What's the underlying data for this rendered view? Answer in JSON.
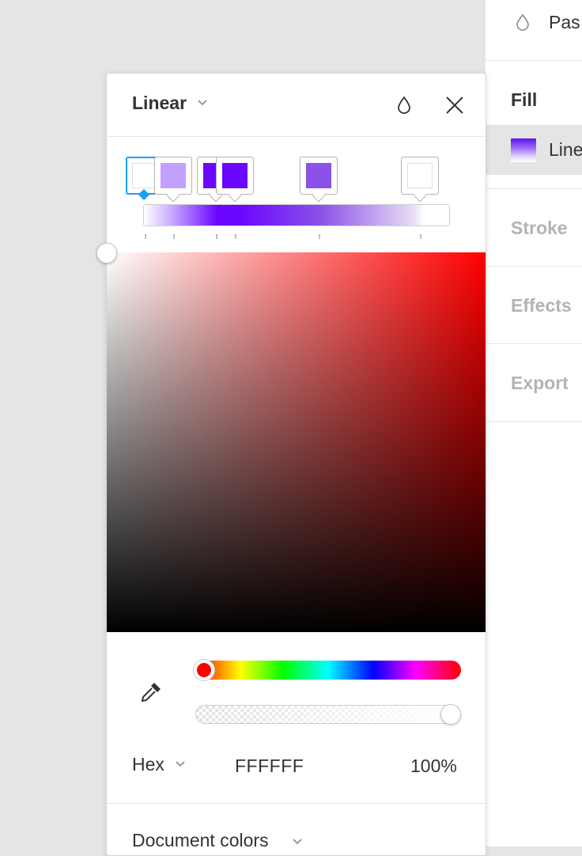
{
  "props": {
    "pas_text": "Pas",
    "fill_title": "Fill",
    "fill_item": "Line",
    "stroke_title": "Stroke",
    "effects_title": "Effects",
    "export_title": "Export"
  },
  "picker": {
    "type_label": "Linear",
    "stops": [
      {
        "color": "#ffffff",
        "selected": true
      },
      {
        "color": "#c3a1ff"
      },
      {
        "color": "#6b07ff"
      },
      {
        "color": "#6b07ff"
      },
      {
        "color": "#8a52e6"
      },
      {
        "color": "#ffffff"
      }
    ],
    "format_label": "Hex",
    "hex_value": "FFFFFF",
    "opacity_value": "100%",
    "document_colors_label": "Document colors"
  },
  "icons": {
    "opacity": "opacity-drop-icon",
    "close": "close-icon",
    "eyedropper": "eyedropper-icon",
    "chevron": "chevron-down-icon"
  },
  "colors": {
    "selection": "#18a0fb",
    "hue": "#ff0000"
  }
}
